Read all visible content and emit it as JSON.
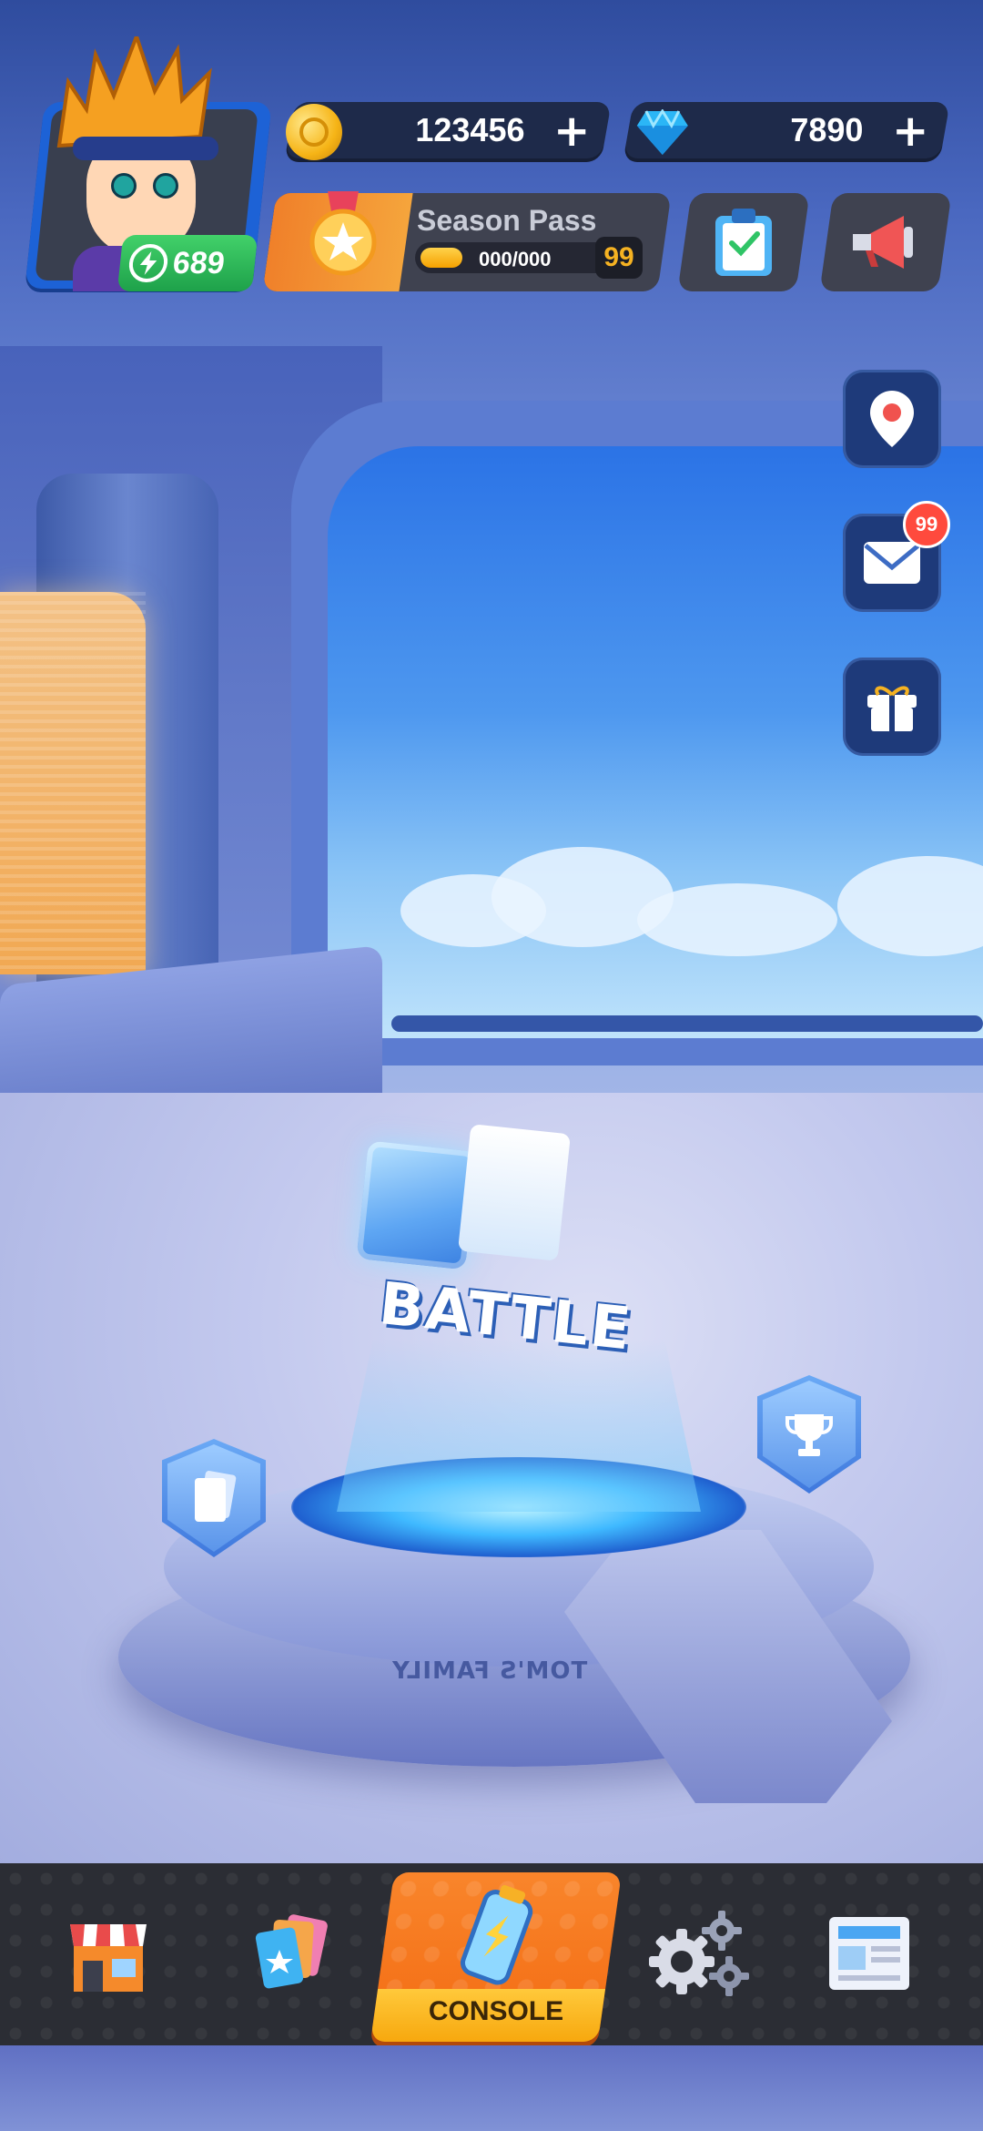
{
  "player": {
    "energy": "689"
  },
  "currencies": {
    "coins": "123456",
    "gems": "7890",
    "add_symbol": "+"
  },
  "season_pass": {
    "title": "Season Pass",
    "progress_text": "000/000",
    "level": "99",
    "progress_fraction": 0.2
  },
  "side_buttons": {
    "mail_badge": "99"
  },
  "scene": {
    "battle_label": "BATTLE",
    "platform_text": "TOM'S FAMILY"
  },
  "bottom_nav": {
    "items": [
      "shop",
      "cards",
      "console",
      "settings",
      "news"
    ],
    "active_label": "CONSOLE"
  },
  "colors": {
    "accent_orange": "#f36b12",
    "energy_green": "#1ea14a",
    "badge_red": "#ff4a3d",
    "nav_dark": "#2b2d34"
  }
}
